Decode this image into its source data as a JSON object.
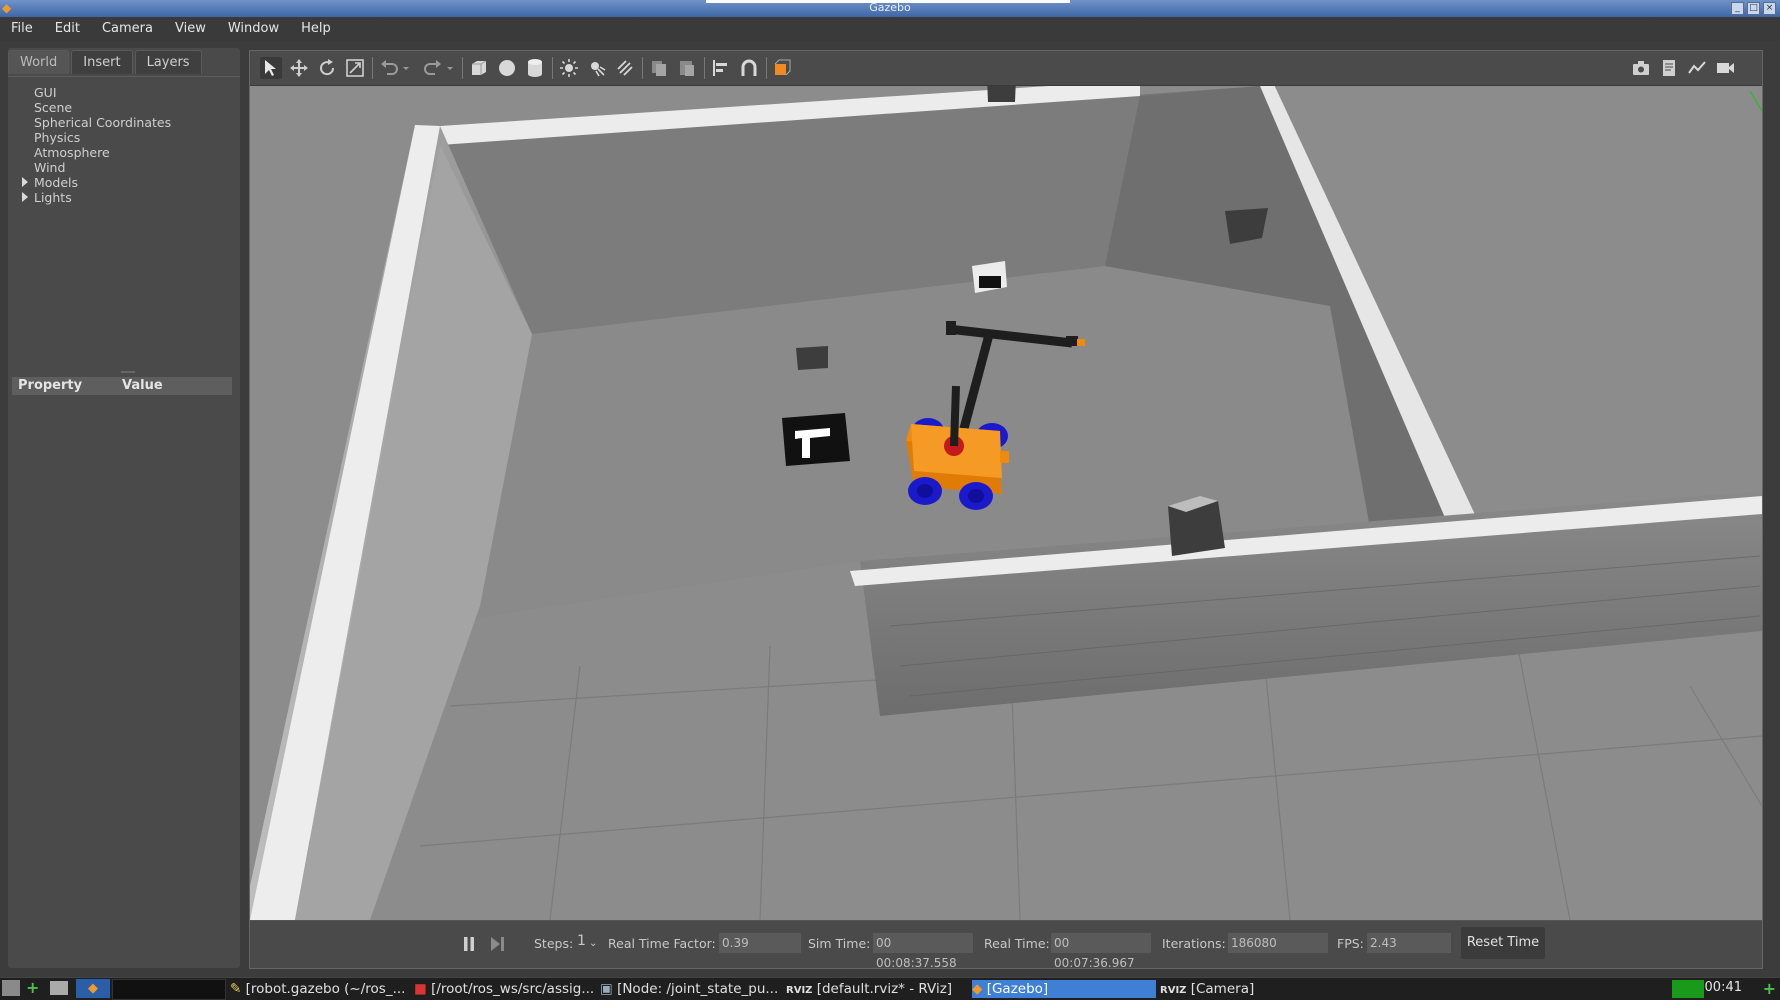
{
  "window": {
    "title": "Gazebo"
  },
  "menu": [
    "File",
    "Edit",
    "Camera",
    "View",
    "Window",
    "Help"
  ],
  "left_panel": {
    "tabs": [
      "World",
      "Insert",
      "Layers"
    ],
    "tree": [
      "GUI",
      "Scene",
      "Spherical Coordinates",
      "Physics",
      "Atmosphere",
      "Wind",
      "Models",
      "Lights"
    ],
    "property_header": {
      "property": "Property",
      "value": "Value"
    }
  },
  "toolbar": {
    "left_icons": [
      "select-icon",
      "translate-icon",
      "rotate-icon",
      "scale-icon",
      "undo-icon",
      "redo-icon",
      "box-icon",
      "sphere-icon",
      "cylinder-icon",
      "point-light-icon",
      "spot-light-icon",
      "directional-light-icon",
      "copy-icon",
      "paste-icon",
      "align-icon",
      "snap-icon",
      "view-angle-icon"
    ],
    "right_icons": [
      "screenshot-icon",
      "log-icon",
      "plot-icon",
      "video-record-icon"
    ]
  },
  "status": {
    "steps_label": "Steps:",
    "steps_value": "1",
    "rtf_label": "Real Time Factor:",
    "rtf_value": "0.39",
    "sim_time_label": "Sim Time:",
    "sim_time_value": "00 00:08:37.558",
    "real_time_label": "Real Time:",
    "real_time_value": "00 00:07:36.967",
    "iterations_label": "Iterations:",
    "iterations_value": "186080",
    "fps_label": "FPS:",
    "fps_value": "2.43",
    "reset_label": "Reset Time"
  },
  "taskbar": {
    "items": [
      "[robot.gazebo (~/ros_...",
      "[/root/ros_ws/src/assig...",
      "[Node: /joint_state_pu...",
      "[default.rviz* - RViz]",
      "[Gazebo]",
      "[Camera]"
    ],
    "clock": "00:41"
  },
  "colors": {
    "robot_body": "#f2890a",
    "wheels": "#1a1acc",
    "accent": "#3f7fd6"
  }
}
